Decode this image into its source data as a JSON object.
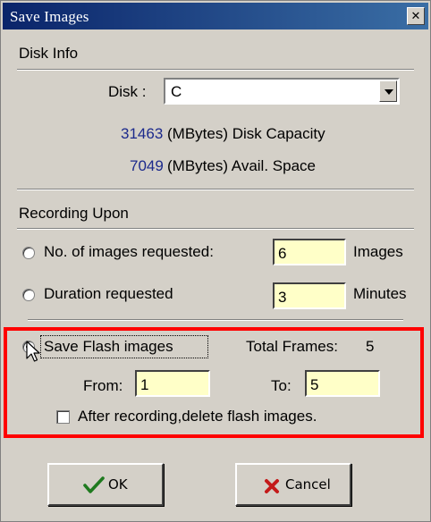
{
  "window": {
    "title": "Save Images"
  },
  "disk_info": {
    "group_label": "Disk Info",
    "disk_label": "Disk :",
    "disk_value": "C",
    "capacity_value": "31463",
    "capacity_label": "(MBytes) Disk Capacity",
    "avail_value": "7049",
    "avail_label": "(MBytes) Avail. Space"
  },
  "recording": {
    "group_label": "Recording Upon",
    "images_option": {
      "label": "No. of images requested:",
      "value": "6",
      "unit": "Images"
    },
    "duration_option": {
      "label": "Duration requested",
      "value": "3",
      "unit": "Minutes"
    },
    "flash_option": {
      "label": "Save Flash images",
      "total_frames_label": "Total Frames:",
      "total_frames_value": "5",
      "from_label": "From:",
      "from_value": "1",
      "to_label": "To:",
      "to_value": "5",
      "delete_label": "After recording,delete flash images."
    }
  },
  "buttons": {
    "ok": "OK",
    "cancel": "Cancel"
  },
  "colors": {
    "highlight": "#ff0000",
    "input_bg": "#ffffc8",
    "value_blue": "#1c2a8c"
  }
}
